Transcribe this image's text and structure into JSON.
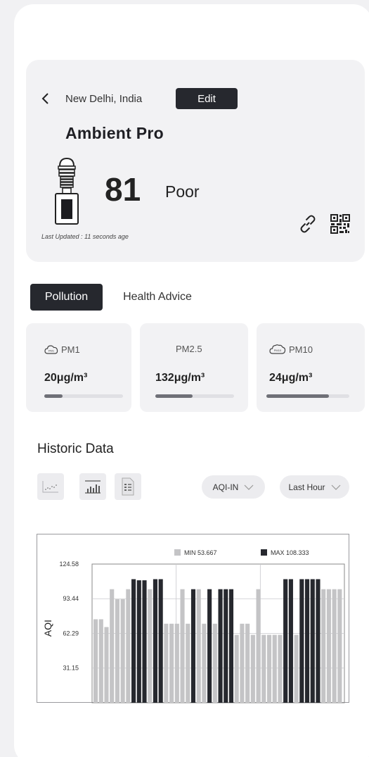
{
  "location": {
    "name": "New Delhi, India",
    "edit_label": "Edit"
  },
  "device": {
    "name": "Ambient Pro",
    "aqi": "81",
    "status": "Poor",
    "last_updated": "Last Updated : 11 seconds age"
  },
  "tabs": [
    {
      "label": "Pollution",
      "active": true
    },
    {
      "label": "Health Advice",
      "active": false
    }
  ],
  "pollutants": [
    {
      "label": "PM1",
      "value": "20μg/m³",
      "level": 0.23,
      "icon": "cloud-icon"
    },
    {
      "label": "PM2.5",
      "value": "132μg/m³",
      "level": 0.47,
      "icon": ""
    },
    {
      "label": "PM10",
      "value": "24μg/m³",
      "level": 0.75,
      "icon": "cloud-icon"
    }
  ],
  "historic": {
    "title": "Historic Data",
    "metric_select": "AQI-IN",
    "range_select": "Last Hour",
    "view_icons": [
      "scatter-chart-icon",
      "bar-chart-icon",
      "table-view-icon"
    ]
  },
  "chart_data": {
    "type": "bar",
    "ylabel": "AQI",
    "ylim": [
      0,
      124.58
    ],
    "yticks": [
      "124.58",
      "93.44",
      "62.29",
      "31.15"
    ],
    "legend": [
      {
        "label": "MIN 53.667",
        "color": "#c4c4c6"
      },
      {
        "label": "MAX 108.333",
        "color": "#26282e"
      }
    ],
    "legend_position": "top",
    "grid": true,
    "values": [
      75,
      75,
      68,
      102,
      93,
      93,
      102,
      111,
      110,
      110,
      102,
      111,
      111,
      71,
      71,
      71,
      102,
      71,
      102,
      102,
      71,
      102,
      71,
      102,
      102,
      102,
      61,
      71,
      71,
      61,
      102,
      61,
      61,
      61,
      61,
      111,
      111,
      61,
      111,
      111,
      111,
      111,
      102,
      102,
      102,
      102
    ],
    "dark": [
      false,
      false,
      false,
      false,
      false,
      false,
      false,
      true,
      true,
      true,
      false,
      true,
      true,
      false,
      false,
      false,
      false,
      false,
      true,
      false,
      false,
      true,
      false,
      true,
      true,
      true,
      false,
      false,
      false,
      false,
      false,
      false,
      false,
      false,
      false,
      true,
      true,
      false,
      true,
      true,
      true,
      true,
      false,
      false,
      false,
      false
    ],
    "colors": {
      "light": "#c4c4c6",
      "dark": "#26282e"
    }
  }
}
